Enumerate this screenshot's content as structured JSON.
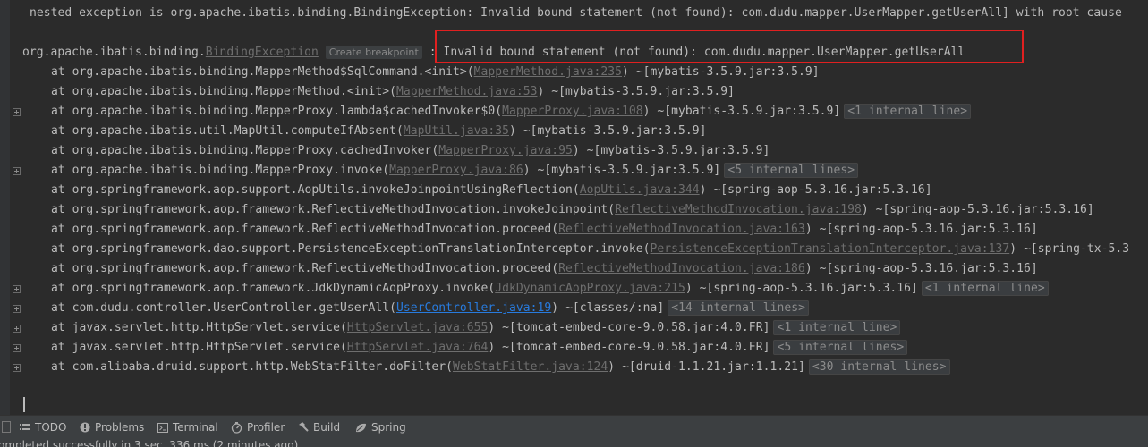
{
  "console": {
    "header": "nested exception is org.apache.ibatis.binding.BindingException: Invalid bound statement (not found): com.dudu.mapper.UserMapper.getUserAll] with root cause",
    "exception_prefix": "org.apache.ibatis.binding.",
    "exception_class": "BindingException",
    "breakpoint_hint": "Create breakpoint",
    "exception_sep": ":",
    "exception_message": "Invalid bound statement (not found): com.dudu.mapper.UserMapper.getUserAll",
    "frames": [
      {
        "fold": false,
        "text": "at org.apache.ibatis.binding.MapperMethod$SqlCommand.<init>(",
        "src": "MapperMethod.java:235",
        "jar": ") ~[mybatis-3.5.9.jar:3.5.9]",
        "hint": ""
      },
      {
        "fold": false,
        "text": "at org.apache.ibatis.binding.MapperMethod.<init>(",
        "src": "MapperMethod.java:53",
        "jar": ") ~[mybatis-3.5.9.jar:3.5.9]",
        "hint": ""
      },
      {
        "fold": true,
        "text": "at org.apache.ibatis.binding.MapperProxy.lambda$cachedInvoker$0(",
        "src": "MapperProxy.java:108",
        "jar": ") ~[mybatis-3.5.9.jar:3.5.9]",
        "hint": "<1 internal line>"
      },
      {
        "fold": false,
        "text": "at org.apache.ibatis.util.MapUtil.computeIfAbsent(",
        "src": "MapUtil.java:35",
        "jar": ") ~[mybatis-3.5.9.jar:3.5.9]",
        "hint": ""
      },
      {
        "fold": false,
        "text": "at org.apache.ibatis.binding.MapperProxy.cachedInvoker(",
        "src": "MapperProxy.java:95",
        "jar": ") ~[mybatis-3.5.9.jar:3.5.9]",
        "hint": ""
      },
      {
        "fold": true,
        "text": "at org.apache.ibatis.binding.MapperProxy.invoke(",
        "src": "MapperProxy.java:86",
        "jar": ") ~[mybatis-3.5.9.jar:3.5.9]",
        "hint": "<5 internal lines>"
      },
      {
        "fold": false,
        "text": "at org.springframework.aop.support.AopUtils.invokeJoinpointUsingReflection(",
        "src": "AopUtils.java:344",
        "jar": ") ~[spring-aop-5.3.16.jar:5.3.16]",
        "hint": ""
      },
      {
        "fold": false,
        "text": "at org.springframework.aop.framework.ReflectiveMethodInvocation.invokeJoinpoint(",
        "src": "ReflectiveMethodInvocation.java:198",
        "jar": ") ~[spring-aop-5.3.16.jar:5.3.16]",
        "hint": ""
      },
      {
        "fold": false,
        "text": "at org.springframework.aop.framework.ReflectiveMethodInvocation.proceed(",
        "src": "ReflectiveMethodInvocation.java:163",
        "jar": ") ~[spring-aop-5.3.16.jar:5.3.16]",
        "hint": ""
      },
      {
        "fold": false,
        "text": "at org.springframework.dao.support.PersistenceExceptionTranslationInterceptor.invoke(",
        "src": "PersistenceExceptionTranslationInterceptor.java:137",
        "jar": ") ~[spring-tx-5.3",
        "hint": ""
      },
      {
        "fold": false,
        "text": "at org.springframework.aop.framework.ReflectiveMethodInvocation.proceed(",
        "src": "ReflectiveMethodInvocation.java:186",
        "jar": ") ~[spring-aop-5.3.16.jar:5.3.16]",
        "hint": ""
      },
      {
        "fold": true,
        "text": "at org.springframework.aop.framework.JdkDynamicAopProxy.invoke(",
        "src": "JdkDynamicAopProxy.java:215",
        "jar": ") ~[spring-aop-5.3.16.jar:5.3.16]",
        "hint": "<1 internal line>"
      },
      {
        "fold": true,
        "text": "at com.dudu.controller.UserController.getUserAll(",
        "src": "UserController.java:19",
        "own": true,
        "jar": ") ~[classes/:na]",
        "hint": "<14 internal lines>"
      },
      {
        "fold": true,
        "text": "at javax.servlet.http.HttpServlet.service(",
        "src": "HttpServlet.java:655",
        "jar": ") ~[tomcat-embed-core-9.0.58.jar:4.0.FR]",
        "hint": "<1 internal line>"
      },
      {
        "fold": true,
        "text": "at javax.servlet.http.HttpServlet.service(",
        "src": "HttpServlet.java:764",
        "jar": ") ~[tomcat-embed-core-9.0.58.jar:4.0.FR]",
        "hint": "<5 internal lines>"
      },
      {
        "fold": true,
        "text": "at com.alibaba.druid.support.http.WebStatFilter.doFilter(",
        "src": "WebStatFilter.java:124",
        "jar": ") ~[druid-1.1.21.jar:1.1.21]",
        "hint": "<30 internal lines>"
      }
    ]
  },
  "toolbar": {
    "todo": {
      "label": "TODO",
      "icon": "list-icon"
    },
    "problems": {
      "label": "Problems",
      "icon": "info-icon"
    },
    "terminal": {
      "label": "Terminal",
      "icon": "terminal-icon"
    },
    "profiler": {
      "label": "Profiler",
      "icon": "profiler-icon"
    },
    "build": {
      "label": "Build",
      "icon": "hammer-icon"
    },
    "spring": {
      "label": "Spring",
      "icon": "leaf-icon"
    }
  },
  "statusbar": {
    "message": "ompleted successfully in 3 sec, 336 ms (2 minutes ago)"
  },
  "colors": {
    "background": "#2b2b2b",
    "text": "#bbbbbb",
    "link": "#6e6e6e",
    "own_link": "#287bde",
    "highlight_box": "#e02020"
  }
}
